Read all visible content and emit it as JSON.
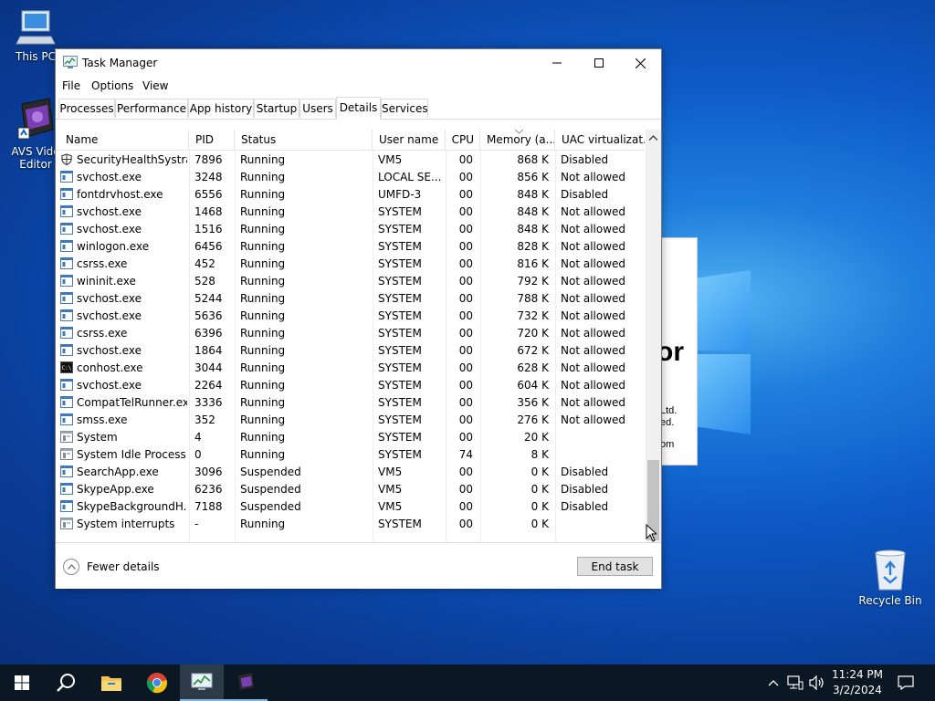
{
  "desktop": {
    "icons": [
      {
        "label": "This PC"
      },
      {
        "label": "AVS Vide"
      },
      {
        "label": "Editor"
      },
      {
        "label": "Recycle Bin"
      }
    ],
    "background_app": {
      "big": "or",
      "line1": "Ltd.",
      "line2": "ed.",
      "line3": "om"
    }
  },
  "window": {
    "title": "Task Manager",
    "menu": [
      "File",
      "Options",
      "View"
    ],
    "tabs": [
      "Processes",
      "Performance",
      "App history",
      "Startup",
      "Users",
      "Details",
      "Services"
    ],
    "active_tab": "Details",
    "columns": [
      "Name",
      "PID",
      "Status",
      "User name",
      "CPU",
      "Memory (a...",
      "UAC virtualizat..."
    ],
    "rows": [
      {
        "name": "SecurityHealthSystra...",
        "pid": "7896",
        "status": "Running",
        "user": "VM5",
        "cpu": "00",
        "mem": "868 K",
        "uac": "Disabled",
        "icon": "shield-icon"
      },
      {
        "name": "svchost.exe",
        "pid": "3248",
        "status": "Running",
        "user": "LOCAL SE...",
        "cpu": "00",
        "mem": "856 K",
        "uac": "Not allowed",
        "icon": "window-process-icon"
      },
      {
        "name": "fontdrvhost.exe",
        "pid": "6556",
        "status": "Running",
        "user": "UMFD-3",
        "cpu": "00",
        "mem": "848 K",
        "uac": "Disabled",
        "icon": "window-process-icon"
      },
      {
        "name": "svchost.exe",
        "pid": "1468",
        "status": "Running",
        "user": "SYSTEM",
        "cpu": "00",
        "mem": "848 K",
        "uac": "Not allowed",
        "icon": "window-process-icon"
      },
      {
        "name": "svchost.exe",
        "pid": "1516",
        "status": "Running",
        "user": "SYSTEM",
        "cpu": "00",
        "mem": "848 K",
        "uac": "Not allowed",
        "icon": "window-process-icon"
      },
      {
        "name": "winlogon.exe",
        "pid": "6456",
        "status": "Running",
        "user": "SYSTEM",
        "cpu": "00",
        "mem": "828 K",
        "uac": "Not allowed",
        "icon": "window-process-icon"
      },
      {
        "name": "csrss.exe",
        "pid": "452",
        "status": "Running",
        "user": "SYSTEM",
        "cpu": "00",
        "mem": "816 K",
        "uac": "Not allowed",
        "icon": "window-process-icon"
      },
      {
        "name": "wininit.exe",
        "pid": "528",
        "status": "Running",
        "user": "SYSTEM",
        "cpu": "00",
        "mem": "792 K",
        "uac": "Not allowed",
        "icon": "window-process-icon"
      },
      {
        "name": "svchost.exe",
        "pid": "5244",
        "status": "Running",
        "user": "SYSTEM",
        "cpu": "00",
        "mem": "788 K",
        "uac": "Not allowed",
        "icon": "window-process-icon"
      },
      {
        "name": "svchost.exe",
        "pid": "5636",
        "status": "Running",
        "user": "SYSTEM",
        "cpu": "00",
        "mem": "732 K",
        "uac": "Not allowed",
        "icon": "window-process-icon"
      },
      {
        "name": "csrss.exe",
        "pid": "6396",
        "status": "Running",
        "user": "SYSTEM",
        "cpu": "00",
        "mem": "720 K",
        "uac": "Not allowed",
        "icon": "window-process-icon"
      },
      {
        "name": "svchost.exe",
        "pid": "1864",
        "status": "Running",
        "user": "SYSTEM",
        "cpu": "00",
        "mem": "672 K",
        "uac": "Not allowed",
        "icon": "window-process-icon"
      },
      {
        "name": "conhost.exe",
        "pid": "3044",
        "status": "Running",
        "user": "SYSTEM",
        "cpu": "00",
        "mem": "628 K",
        "uac": "Not allowed",
        "icon": "console-icon"
      },
      {
        "name": "svchost.exe",
        "pid": "2264",
        "status": "Running",
        "user": "SYSTEM",
        "cpu": "00",
        "mem": "604 K",
        "uac": "Not allowed",
        "icon": "window-process-icon"
      },
      {
        "name": "CompatTelRunner.exe",
        "pid": "3336",
        "status": "Running",
        "user": "SYSTEM",
        "cpu": "00",
        "mem": "356 K",
        "uac": "Not allowed",
        "icon": "window-process-icon"
      },
      {
        "name": "smss.exe",
        "pid": "352",
        "status": "Running",
        "user": "SYSTEM",
        "cpu": "00",
        "mem": "276 K",
        "uac": "Not allowed",
        "icon": "window-process-icon"
      },
      {
        "name": "System",
        "pid": "4",
        "status": "Running",
        "user": "SYSTEM",
        "cpu": "00",
        "mem": "20 K",
        "uac": "",
        "icon": "system-process-icon"
      },
      {
        "name": "System Idle Process",
        "pid": "0",
        "status": "Running",
        "user": "SYSTEM",
        "cpu": "74",
        "mem": "8 K",
        "uac": "",
        "icon": "system-process-icon"
      },
      {
        "name": "SearchApp.exe",
        "pid": "3096",
        "status": "Suspended",
        "user": "VM5",
        "cpu": "00",
        "mem": "0 K",
        "uac": "Disabled",
        "icon": "window-process-icon"
      },
      {
        "name": "SkypeApp.exe",
        "pid": "6236",
        "status": "Suspended",
        "user": "VM5",
        "cpu": "00",
        "mem": "0 K",
        "uac": "Disabled",
        "icon": "window-process-icon"
      },
      {
        "name": "SkypeBackgroundH...",
        "pid": "7188",
        "status": "Suspended",
        "user": "VM5",
        "cpu": "00",
        "mem": "0 K",
        "uac": "Disabled",
        "icon": "window-process-icon"
      },
      {
        "name": "System interrupts",
        "pid": "-",
        "status": "Running",
        "user": "SYSTEM",
        "cpu": "00",
        "mem": "0 K",
        "uac": "",
        "icon": "system-process-icon"
      }
    ],
    "fewer_details": "Fewer details",
    "end_task": "End task"
  },
  "taskbar": {
    "time": "11:24 PM",
    "date": "3/2/2024",
    "pinned": [
      "start-icon",
      "search-icon",
      "file-explorer-icon",
      "chrome-icon",
      "task-manager-icon",
      "avs-video-editor-icon"
    ]
  },
  "colors": {
    "accent": "#0078d7",
    "taskbar": "#0c1724",
    "desktop": "#0d5ac7"
  }
}
